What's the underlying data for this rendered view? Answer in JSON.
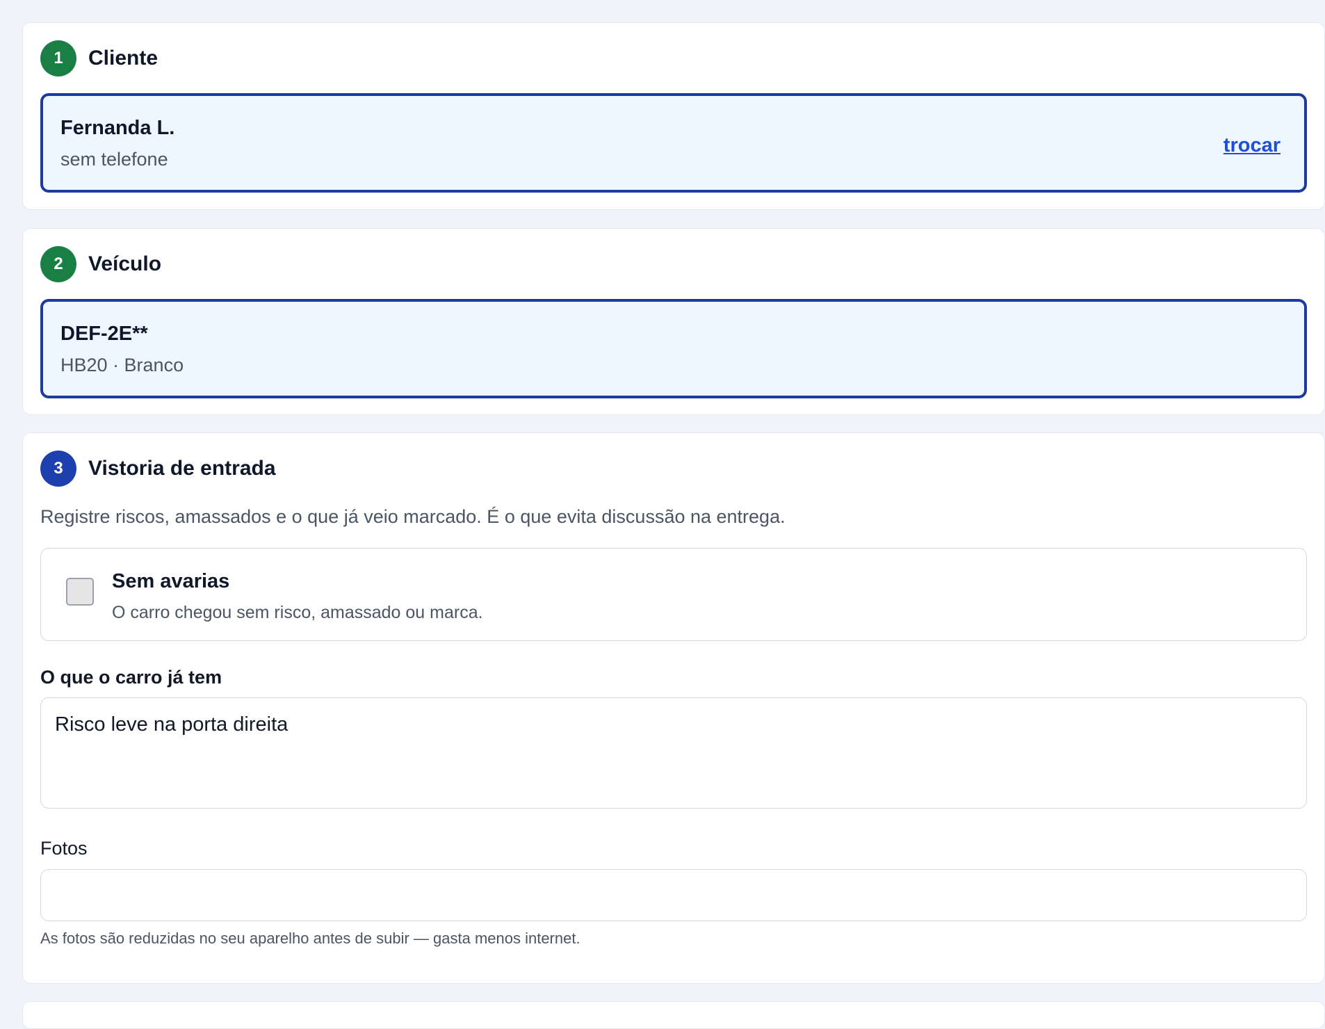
{
  "steps": [
    {
      "number": "1",
      "title": "Cliente",
      "selected": {
        "name": "Fernanda L.",
        "detail": "sem telefone",
        "action": "trocar"
      }
    },
    {
      "number": "2",
      "title": "Veículo",
      "selected": {
        "name": "DEF-2E**",
        "detail": "HB20 · Branco"
      }
    },
    {
      "number": "3",
      "title": "Vistoria de entrada",
      "intro": "Registre riscos, amassados e o que já veio marcado. É o que evita discussão na entrega.",
      "no_damage": {
        "label": "Sem avarias",
        "description": "O carro chegou sem risco, amassado ou marca.",
        "checked": false
      },
      "damage_field": {
        "label": "O que o carro já tem",
        "value": "Risco leve na porta direita"
      },
      "photos_field": {
        "label": "Fotos",
        "hint": "As fotos são reduzidas no seu aparelho antes de subir — gasta menos internet."
      }
    }
  ],
  "colors": {
    "step_done": "#1a7f45",
    "step_active": "#1e40af",
    "selected_border": "#1e3a9f",
    "selected_bg": "#eef6ff",
    "link": "#1d4ed8"
  }
}
